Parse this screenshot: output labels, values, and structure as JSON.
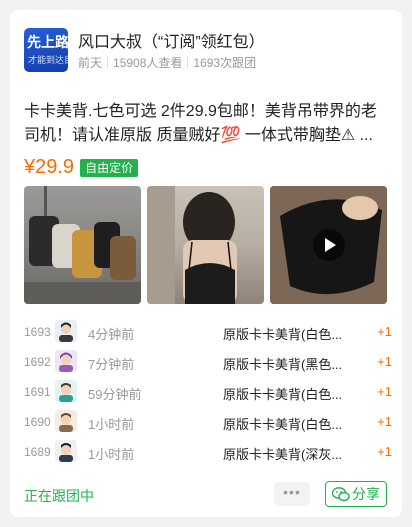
{
  "header": {
    "author": "风口大叔（“订阅”领红包）",
    "time": "前天",
    "views": "15908人查看",
    "follows": "1693次跟团",
    "avatar_text_line1": "先上路",
    "avatar_text_line2": "才能到达目的地"
  },
  "post": {
    "title": "卡卡美背.七色可选 2件29.9包邮！美背吊带界的老司机！请认准原版 质量贼好💯 一体式带胸垫⚠ ...",
    "price": "¥29.9",
    "tag": "自由定价"
  },
  "orders": [
    {
      "num": "1693",
      "time": "4分钟前",
      "product": "原版卡卡美背(白色...",
      "qty": "+1"
    },
    {
      "num": "1692",
      "time": "7分钟前",
      "product": "原版卡卡美背(黑色...",
      "qty": "+1"
    },
    {
      "num": "1691",
      "time": "59分钟前",
      "product": "原版卡卡美背(白色...",
      "qty": "+1"
    },
    {
      "num": "1690",
      "time": "1小时前",
      "product": "原版卡卡美背(白色...",
      "qty": "+1"
    },
    {
      "num": "1689",
      "time": "1小时前",
      "product": "原版卡卡美背(深灰...",
      "qty": "+1"
    }
  ],
  "footer": {
    "status": "正在跟团中",
    "more": "•••",
    "share": "分享"
  },
  "colors": {
    "accent_green": "#22b14c",
    "price_orange": "#ff6a00"
  }
}
